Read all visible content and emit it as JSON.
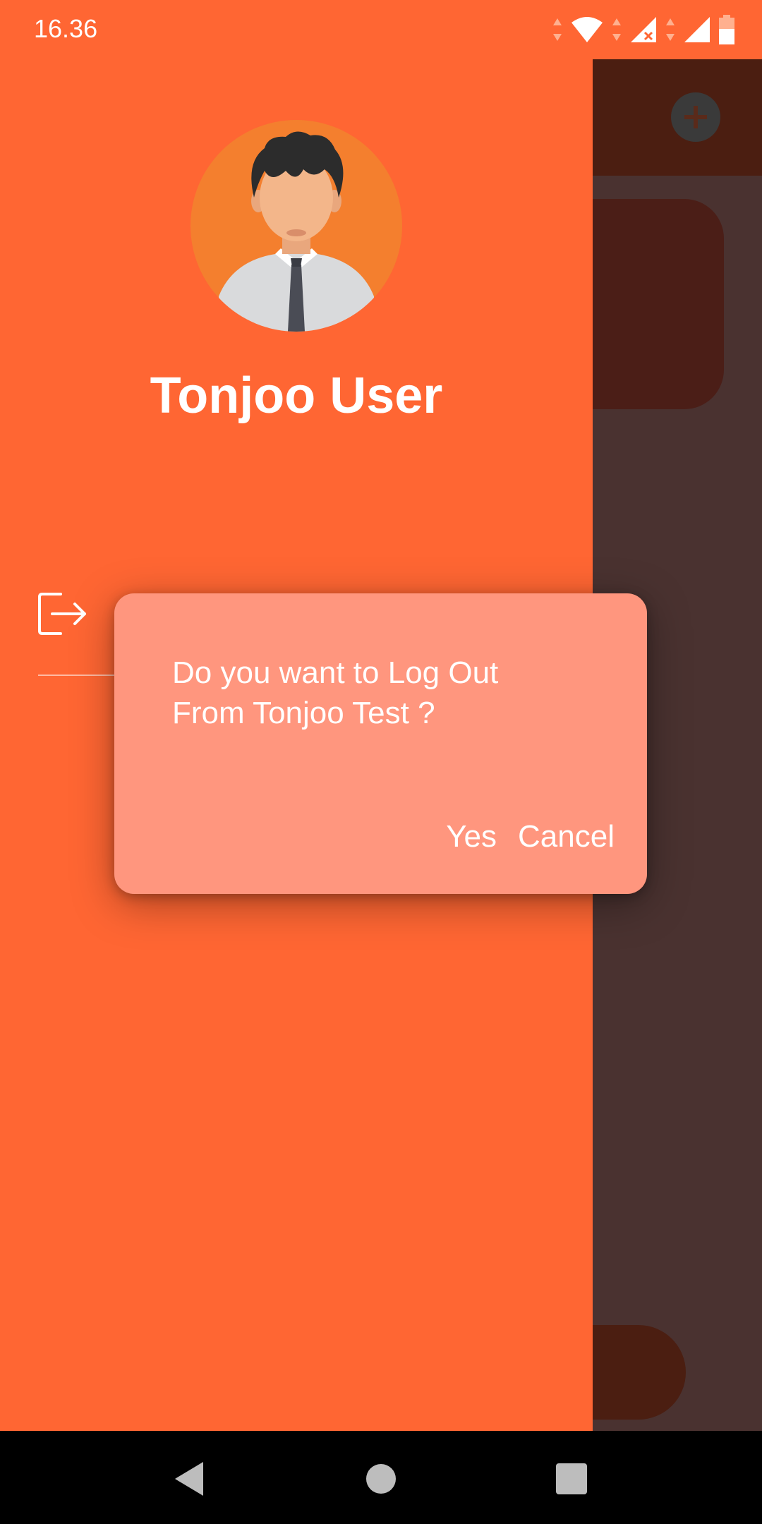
{
  "status_bar": {
    "time": "16.36",
    "icons": [
      "wifi-icon",
      "signal-no-data-icon",
      "signal-icon",
      "battery-icon"
    ]
  },
  "drawer": {
    "avatar_icon": "user-avatar",
    "user_name": "Tonjoo User",
    "items": [
      {
        "icon": "logout-icon",
        "label": ""
      }
    ]
  },
  "dialog": {
    "message": "Do you want to Log Out\nFrom Tonjoo Test ?",
    "confirm_label": "Yes",
    "cancel_label": "Cancel"
  },
  "background_app": {
    "add_icon": "plus-icon"
  },
  "nav_bar": {
    "icons": [
      "back-icon",
      "home-icon",
      "recents-icon"
    ]
  },
  "colors": {
    "accent": "#ff6633",
    "dialog_background": "#ff967e",
    "avatar_background": "#f47f2e",
    "scrim_dark": "#4a3230",
    "text": "#ffffff"
  }
}
